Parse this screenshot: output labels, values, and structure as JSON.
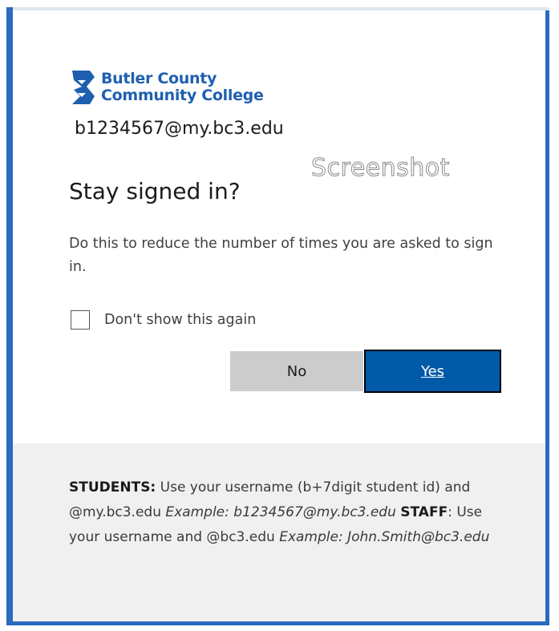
{
  "brand": {
    "name_line1": "Butler County",
    "name_line2": "Community College",
    "colors": {
      "brand_blue": "#1f5fb0",
      "button_blue": "#005aa8",
      "button_gray": "#cccccc",
      "footer_bg": "#f0f0f0"
    },
    "logo_icon": "bc3-logo-icon"
  },
  "account": {
    "email": "b1234567@my.bc3.edu"
  },
  "watermark": "Screenshot",
  "dialog": {
    "title": "Stay signed in?",
    "description": "Do this to reduce the number of times you are asked to sign in.",
    "checkbox_label": "Don't show this again",
    "checkbox_checked": false,
    "no_label": "No",
    "yes_label": "Yes"
  },
  "footer": {
    "students_label": "STUDENTS:",
    "students_text": " Use your username (b+7digit student id) and @my.bc3.edu ",
    "students_example": "Example: b1234567@my.bc3.edu",
    "staff_label": "STAFF",
    "staff_text": ": Use your username and @bc3.edu ",
    "staff_example": "Example: John.Smith@bc3.edu"
  }
}
